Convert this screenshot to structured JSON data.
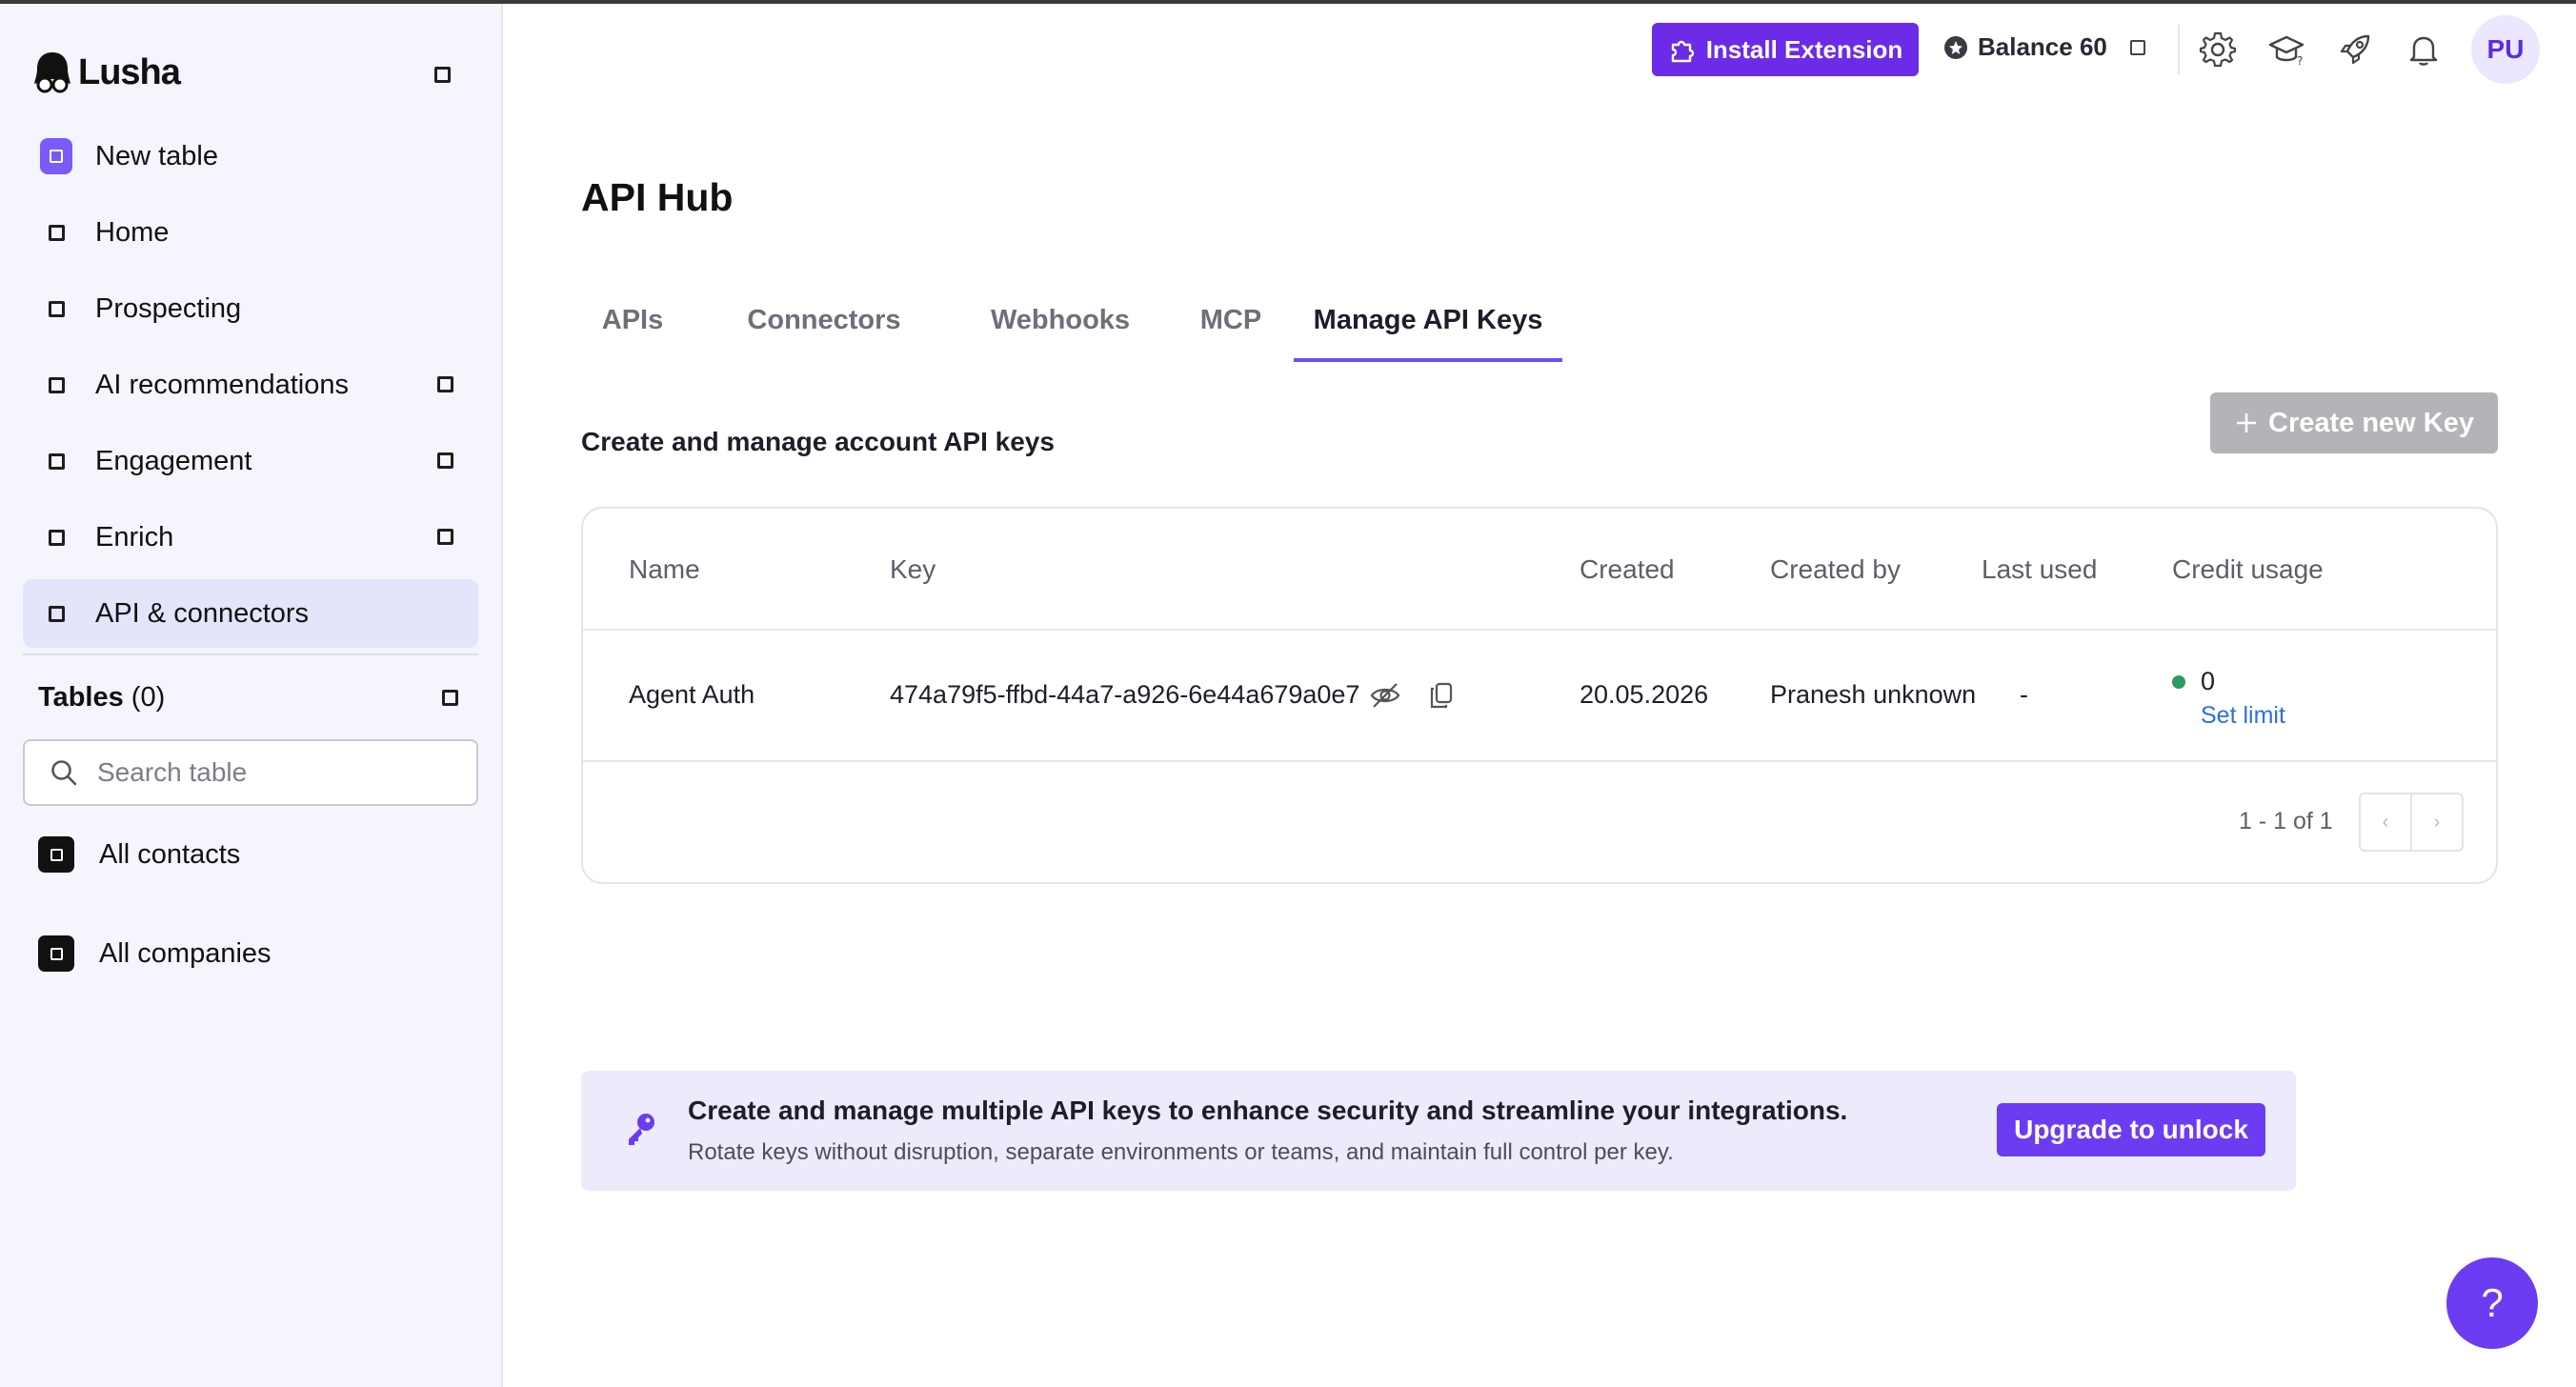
{
  "app": {
    "name": "Lusha"
  },
  "sidebar": {
    "new_table": "New table",
    "items": [
      {
        "label": "Home"
      },
      {
        "label": "Prospecting"
      },
      {
        "label": "AI recommendations"
      },
      {
        "label": "Engagement"
      },
      {
        "label": "Enrich"
      },
      {
        "label": "API & connectors",
        "active": true
      }
    ],
    "tables": {
      "title": "Tables",
      "count": "(0)"
    },
    "search_placeholder": "Search table",
    "table_items": [
      {
        "label": "All contacts"
      },
      {
        "label": "All companies"
      }
    ]
  },
  "topbar": {
    "install_label": "Install Extension",
    "balance_label": "Balance 60",
    "avatar_initials": "PU",
    "icons": [
      "gear-icon",
      "graduation-cap-icon",
      "rocket-icon",
      "bell-icon"
    ]
  },
  "main": {
    "title": "API Hub",
    "tabs": [
      {
        "label": "APIs"
      },
      {
        "label": "Connectors"
      },
      {
        "label": "Webhooks"
      },
      {
        "label": "MCP"
      },
      {
        "label": "Manage API Keys",
        "active": true
      }
    ],
    "section_title": "Create and manage account API keys",
    "create_button": "Create new Key",
    "table": {
      "headers": [
        "Name",
        "Key",
        "Created",
        "Created by",
        "Last used",
        "Credit usage"
      ],
      "rows": [
        {
          "name": "Agent Auth",
          "key": "474a79f5-ffbd-44a7-a926-6e44a679a0e7",
          "created": "20.05.2026",
          "created_by": "Pranesh unknown",
          "last_used": "-",
          "credit_usage": "0",
          "set_limit": "Set limit"
        }
      ],
      "pagination": "1 - 1 of 1"
    },
    "banner": {
      "title": "Create and manage multiple API keys to enhance security and streamline your integrations.",
      "subtitle": "Rotate keys without disruption, separate environments or teams, and maintain full control per key.",
      "button": "Upgrade to unlock"
    }
  },
  "help": {
    "label": "?"
  },
  "colors": {
    "accent": "#6b3cf1",
    "install": "#6b2be8",
    "status_green": "#2e9a5f",
    "link": "#2d6fe3"
  }
}
